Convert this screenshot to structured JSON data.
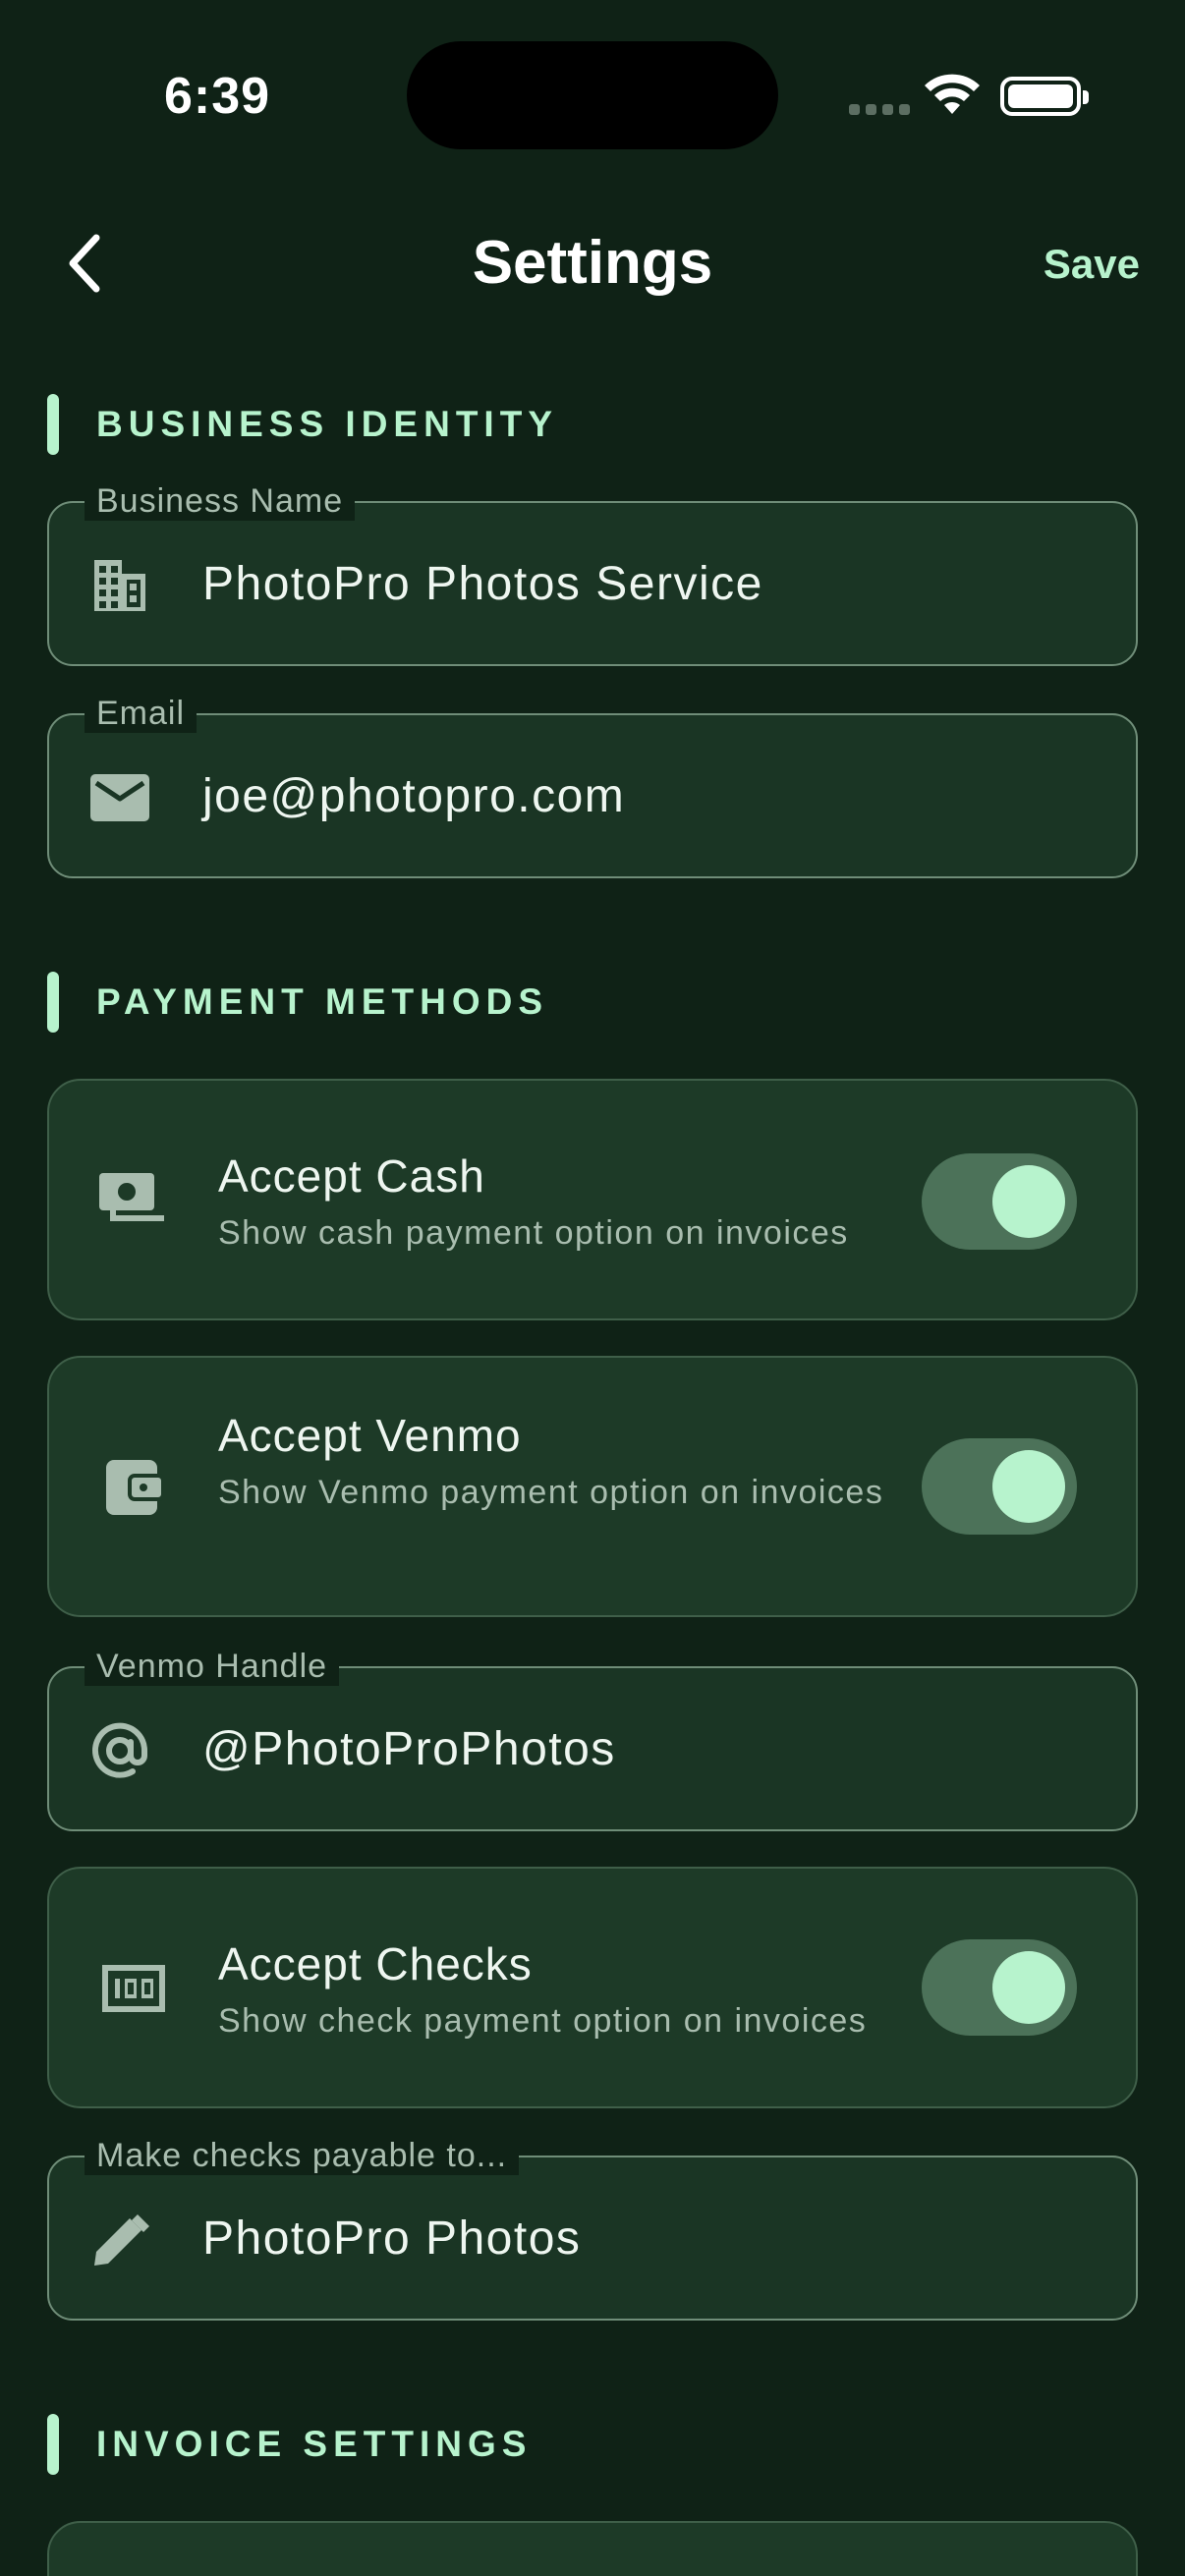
{
  "status_bar": {
    "time": "6:39"
  },
  "nav": {
    "title": "Settings",
    "save_label": "Save"
  },
  "sections": {
    "business_identity": "BUSINESS IDENTITY",
    "payment_methods": "PAYMENT METHODS",
    "invoice_settings": "INVOICE SETTINGS"
  },
  "business": {
    "name_label": "Business Name",
    "name_value": "PhotoPro Photos Service",
    "email_label": "Email",
    "email_value": "joe@photopro.com"
  },
  "payments": {
    "cash": {
      "title": "Accept Cash",
      "subtitle": "Show cash payment option on invoices",
      "enabled": true
    },
    "venmo": {
      "title": "Accept Venmo",
      "subtitle": "Show Venmo payment option on invoices",
      "enabled": true
    },
    "venmo_handle": {
      "label": "Venmo Handle",
      "value": "@PhotoProPhotos"
    },
    "checks": {
      "title": "Accept Checks",
      "subtitle": "Show check payment option on invoices",
      "enabled": true
    },
    "checks_payable": {
      "label": "Make checks payable to...",
      "value": "PhotoPro Photos"
    }
  },
  "icons": {
    "business": "building-icon",
    "email": "mail-icon",
    "cash": "cash-icon",
    "venmo": "wallet-icon",
    "venmo_handle": "at-sign-icon",
    "checks": "check-icon",
    "checks_payable": "pencil-icon"
  },
  "colors": {
    "background": "#0f2216",
    "surface": "#1d3a27",
    "accent": "#b7f3cd",
    "toggle_track": "#4c7259"
  }
}
